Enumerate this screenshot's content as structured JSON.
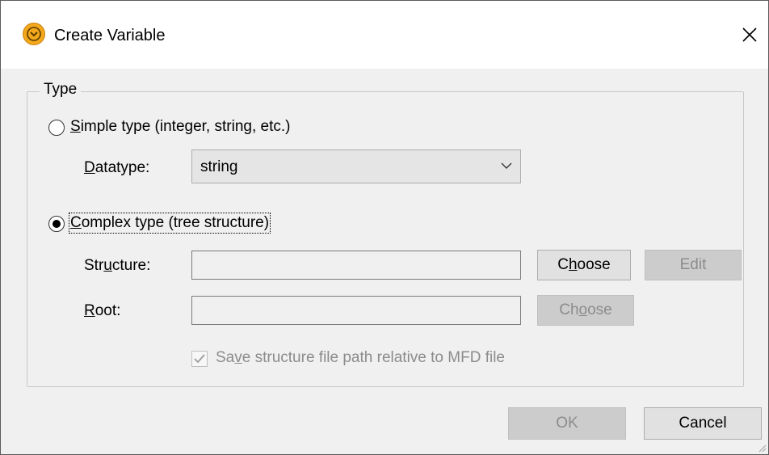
{
  "window": {
    "title": "Create Variable",
    "close_glyph": "✕"
  },
  "group": {
    "label": "Type"
  },
  "simple": {
    "label": "Simple type (integer, string, etc.)",
    "selected": false
  },
  "datatype": {
    "label": "Datatype:",
    "value": "string"
  },
  "complex": {
    "label": "Complex type (tree structure)",
    "selected": true
  },
  "structure": {
    "label": "Structure:",
    "value": "",
    "choose_label": "Choose",
    "edit_label": "Edit"
  },
  "root": {
    "label": "Root:",
    "value": "",
    "choose_label": "Choose"
  },
  "relative_path": {
    "label": "Save structure file path relative to MFD file",
    "checked": true
  },
  "footer": {
    "ok_label": "OK",
    "cancel_label": "Cancel"
  },
  "colors": {
    "app_icon": "#f3a81c",
    "disabled_text": "#8c8c8c",
    "button_face": "#e1e1e1"
  },
  "icons": {
    "app": "altova-mapforce-icon",
    "close": "close-icon",
    "dropdown": "chevron-down-icon",
    "check": "checkmark-icon"
  }
}
